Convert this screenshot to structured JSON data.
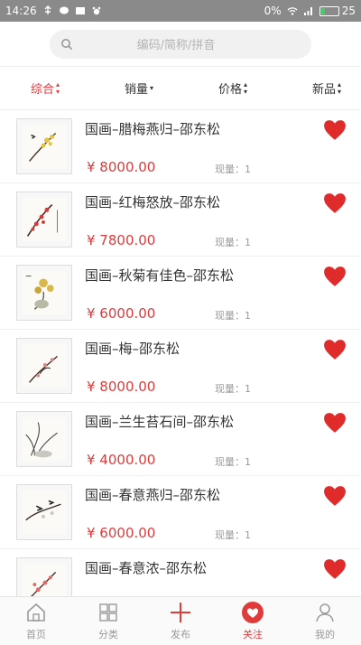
{
  "status": {
    "time": "14:26",
    "signal_text": "0%",
    "battery_level": "25"
  },
  "search": {
    "placeholder": "编码/简称/拼音"
  },
  "sort_tabs": [
    {
      "label": "综合",
      "active": true
    },
    {
      "label": "销量",
      "active": false
    },
    {
      "label": "价格",
      "active": false
    },
    {
      "label": "新品",
      "active": false
    }
  ],
  "products": [
    {
      "title": "国画–腊梅燕归–邵东松",
      "price": "¥ 8000.00",
      "stock": "现量：1"
    },
    {
      "title": "国画–红梅怒放–邵东松",
      "price": "¥ 7800.00",
      "stock": "现量：1"
    },
    {
      "title": "国画–秋菊有佳色–邵东松",
      "price": "¥ 6000.00",
      "stock": "现量：1"
    },
    {
      "title": "国画–梅–邵东松",
      "price": "¥ 8000.00",
      "stock": "现量：1"
    },
    {
      "title": "国画–兰生苔石间–邵东松",
      "price": "¥ 4000.00",
      "stock": "现量：1"
    },
    {
      "title": "国画–春意燕归–邵东松",
      "price": "¥ 6000.00",
      "stock": "现量：1"
    },
    {
      "title": "国画–春意浓–邵东松",
      "price": "",
      "stock": ""
    }
  ],
  "tabbar": [
    {
      "label": "首页",
      "icon": "home-icon"
    },
    {
      "label": "分类",
      "icon": "category-icon"
    },
    {
      "label": "发布",
      "icon": "plus-icon"
    },
    {
      "label": "关注",
      "icon": "heart-icon",
      "active": true
    },
    {
      "label": "我的",
      "icon": "profile-icon"
    }
  ],
  "colors": {
    "accent": "#e03a3a",
    "status_bar": "#8a8a8a"
  }
}
